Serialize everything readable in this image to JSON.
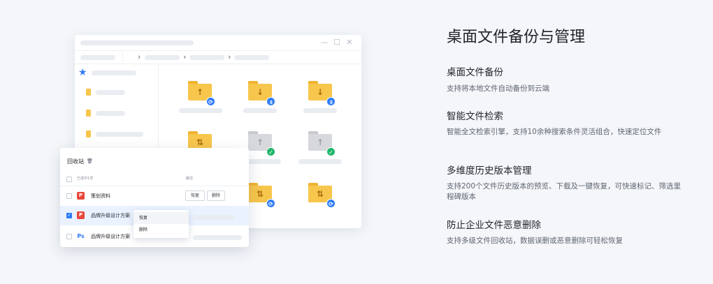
{
  "recycle_bin": {
    "title": "回收站",
    "header": {
      "select_label": "已选中1项",
      "col2_label": "路径"
    },
    "rows": [
      {
        "icon": "P",
        "name": "策划资料",
        "restore": "恢复",
        "delete": "删除"
      },
      {
        "icon": "P",
        "name": "品牌升级设计方案"
      },
      {
        "icon": "Ps",
        "name": "品牌升级设计方案"
      }
    ],
    "context_menu": [
      "恢复",
      "删除"
    ]
  },
  "features": {
    "title": "桌面文件备份与管理",
    "items": [
      {
        "title": "桌面文件备份",
        "desc": "支持将本地文件自动备份到云端"
      },
      {
        "title": "智能文件检索",
        "desc": "智能全文检索引擎，支持10余种搜索条件灵活组合，快速定位文件"
      },
      {
        "title": "多维度历史版本管理",
        "desc": "支持200个文件历史版本的预览、下载及一键恢复，可快速标记、筛选里程碑版本"
      },
      {
        "title": "防止企业文件恶意删除",
        "desc": "支持多级文件回收站，数据误删或恶意删除可轻松恢复"
      }
    ]
  },
  "colors": {
    "accent": "#2f7cf6",
    "folder": "#f7c64c",
    "ok": "#21b66b",
    "danger": "#e8473b"
  }
}
